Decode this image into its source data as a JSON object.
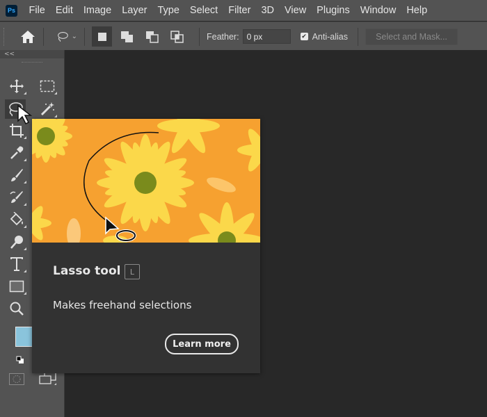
{
  "app": {
    "logo_text": "Ps",
    "brand_color": "#31a8ff"
  },
  "menu": [
    "File",
    "Edit",
    "Image",
    "Layer",
    "Type",
    "Select",
    "Filter",
    "3D",
    "View",
    "Plugins",
    "Window",
    "Help"
  ],
  "options_bar": {
    "feather_label": "Feather:",
    "feather_value": "0 px",
    "anti_alias_label": "Anti-alias",
    "anti_alias_checked": true,
    "select_and_mask_label": "Select and Mask..."
  },
  "toolbar": {
    "collapse_label": "<<",
    "active_tool": "lasso",
    "tools": [
      "move",
      "rectangular-marquee",
      "lasso",
      "magic-wand",
      "crop",
      "eyedropper",
      "brush",
      "healing-brush",
      "paint-bucket",
      "dodge",
      "type",
      "rectangle",
      "zoom"
    ],
    "foreground_color": "#8ac4dc"
  },
  "tooltip": {
    "title": "Lasso tool",
    "shortcut": "L",
    "description": "Makes freehand selections",
    "learn_more_label": "Learn more"
  }
}
